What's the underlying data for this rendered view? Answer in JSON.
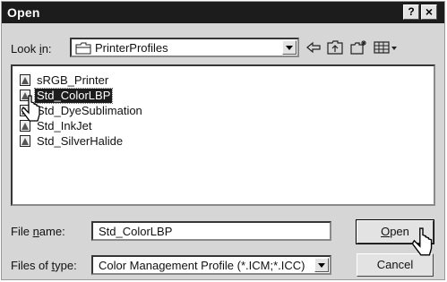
{
  "window": {
    "title": "Open"
  },
  "titlebar": {
    "help_label": "?",
    "close_label": "×"
  },
  "look_in": {
    "label_pre": "Look ",
    "label_key": "i",
    "label_post": "n:",
    "value": "PrinterProfiles"
  },
  "toolbar": {
    "icons": [
      "back-icon",
      "up-folder-icon",
      "new-folder-icon",
      "view-menu-icon"
    ]
  },
  "files": [
    {
      "name": "sRGB_Printer",
      "selected": false
    },
    {
      "name": "Std_ColorLBP",
      "selected": true
    },
    {
      "name": "Std_DyeSublimation",
      "selected": false
    },
    {
      "name": "Std_InkJet",
      "selected": false
    },
    {
      "name": "Std_SilverHalide",
      "selected": false
    }
  ],
  "file_name": {
    "label_pre": "File ",
    "label_key": "n",
    "label_post": "ame:",
    "value": "Std_ColorLBP"
  },
  "file_type": {
    "label_pre": "Files of ",
    "label_key": "t",
    "label_post": "ype:",
    "value": "Color Management Profile (*.ICM;*.ICC)"
  },
  "buttons": {
    "open_key": "O",
    "open_rest": "pen",
    "cancel": "Cancel"
  },
  "colors": {
    "titlebar": "#1c1c1c",
    "dialog": "#d6d6d6",
    "selection": "#1c1c1c"
  }
}
